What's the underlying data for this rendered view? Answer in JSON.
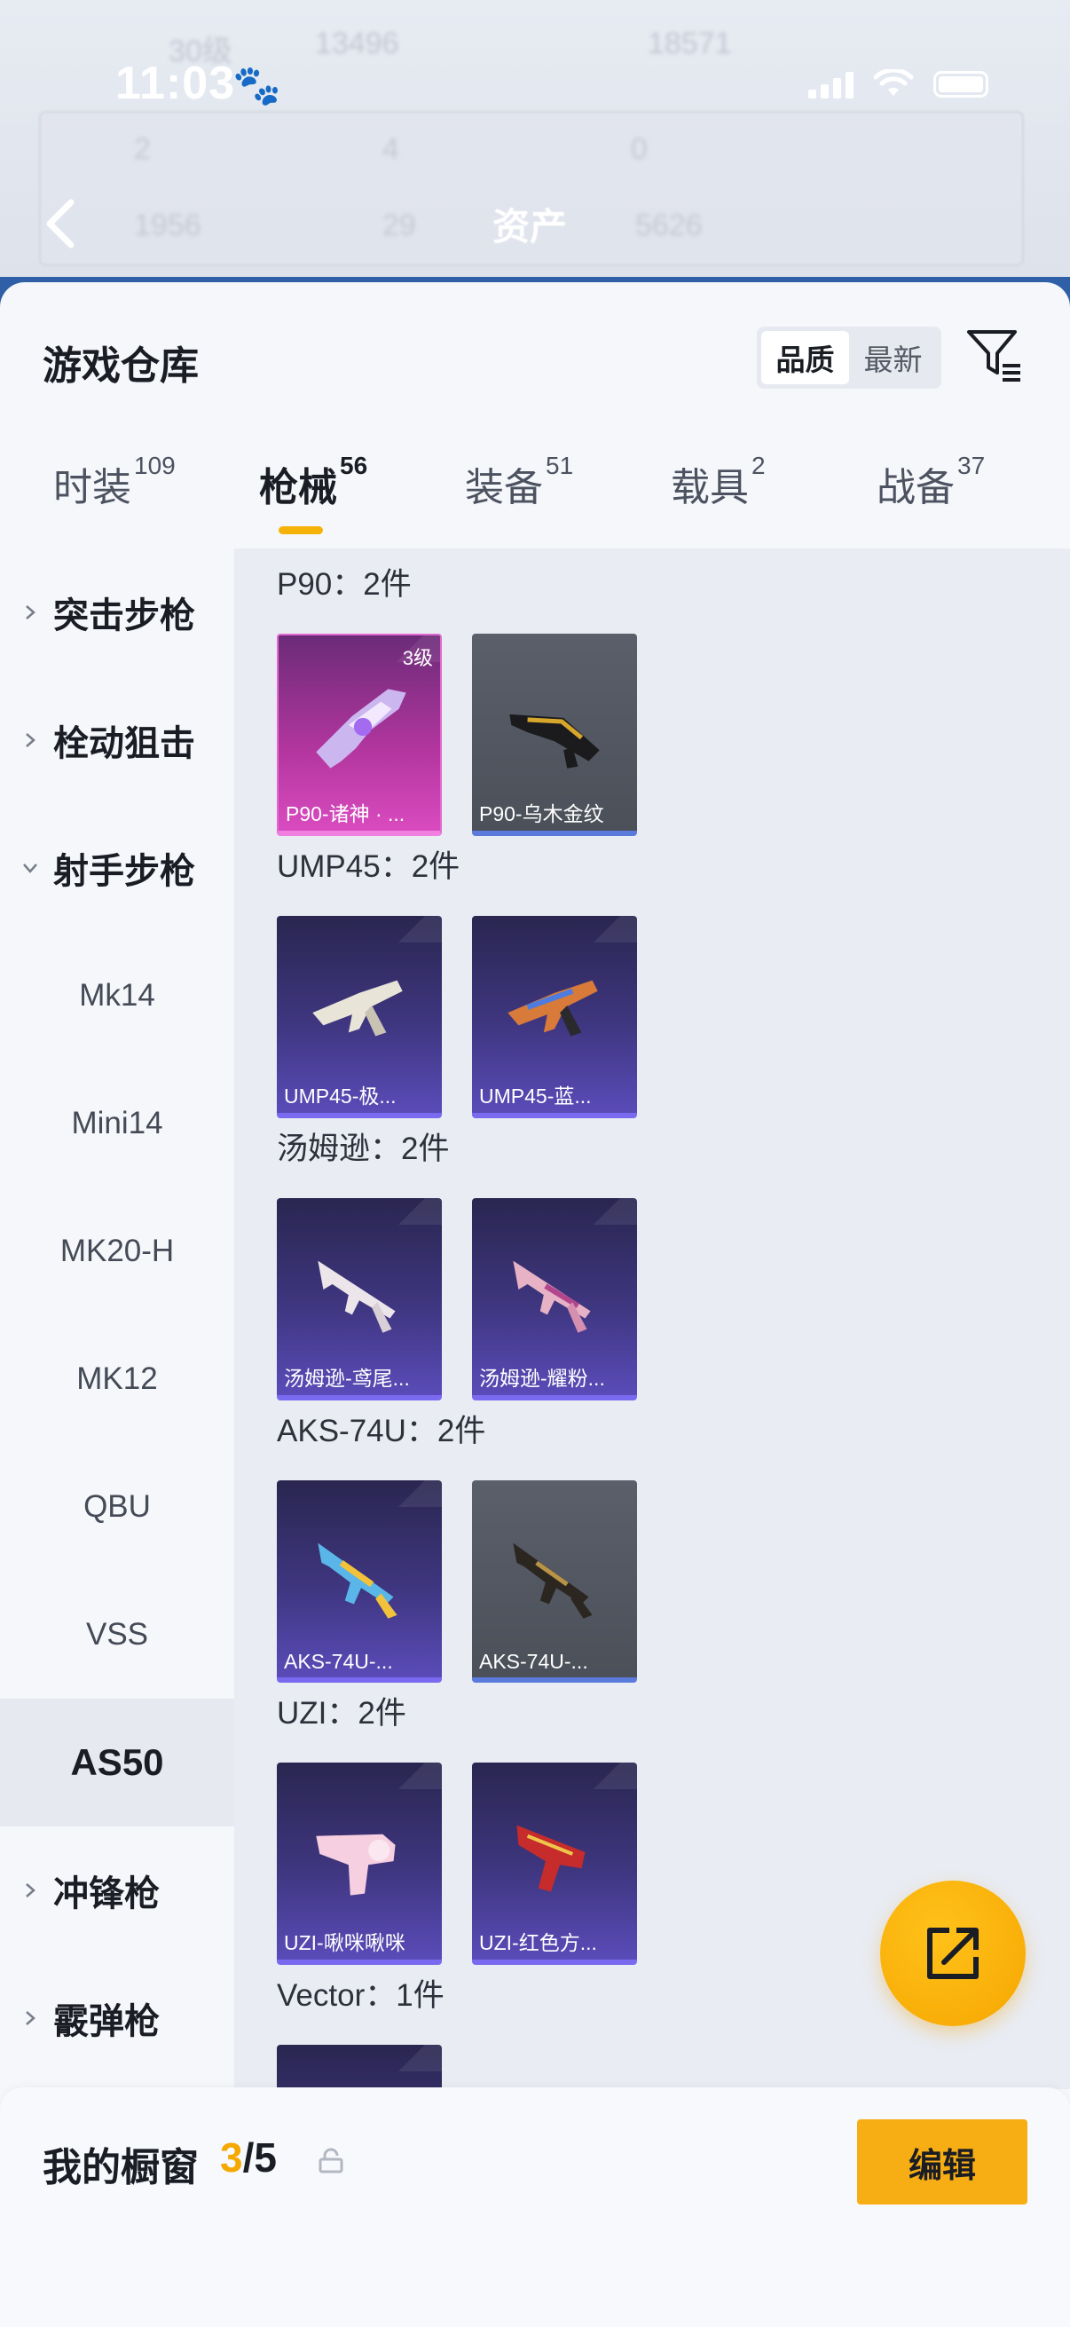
{
  "status": {
    "time": "11:03",
    "paw": "🐾"
  },
  "header": {
    "asset_title": "资产",
    "blur_texts": [
      "30级",
      "13496",
      "18571",
      "2",
      "4",
      "0",
      "1956",
      "29",
      "5626"
    ]
  },
  "sheet": {
    "title": "游戏仓库",
    "sort": {
      "options": [
        "品质",
        "最新"
      ],
      "active": "品质"
    }
  },
  "tabs": [
    {
      "label": "时装",
      "count": "109"
    },
    {
      "label": "枪械",
      "count": "56",
      "active": true
    },
    {
      "label": "装备",
      "count": "51"
    },
    {
      "label": "载具",
      "count": "2"
    },
    {
      "label": "战备",
      "count": "37"
    }
  ],
  "categories": {
    "assault": "突击步枪",
    "bolt": "栓动狙击",
    "marksman": "射手步枪",
    "marksman_items": [
      "Mk14",
      "Mini14",
      "MK20-H",
      "MK12",
      "QBU",
      "VSS",
      "AS50"
    ],
    "selected": "AS50",
    "smg": "冲锋枪",
    "shotgun": "霰弹枪"
  },
  "groups": [
    {
      "title": "P90：2件",
      "items": [
        {
          "name": "P90-诸神 · ...",
          "level": "3级",
          "rarity": "pink"
        },
        {
          "name": "P90-乌木金纹",
          "rarity": "gray"
        }
      ]
    },
    {
      "title": "UMP45：2件",
      "items": [
        {
          "name": "UMP45-极...",
          "rarity": "purple"
        },
        {
          "name": "UMP45-蓝...",
          "rarity": "purple"
        }
      ]
    },
    {
      "title": "汤姆逊：2件",
      "items": [
        {
          "name": "汤姆逊-鸢尾...",
          "rarity": "purple"
        },
        {
          "name": "汤姆逊-耀粉...",
          "rarity": "purple"
        }
      ]
    },
    {
      "title": "AKS-74U：2件",
      "items": [
        {
          "name": "AKS-74U-...",
          "rarity": "purple"
        },
        {
          "name": "AKS-74U-...",
          "rarity": "gray"
        }
      ]
    },
    {
      "title": "UZI：2件",
      "items": [
        {
          "name": "UZI-啾咪啾咪",
          "rarity": "purple"
        },
        {
          "name": "UZI-红色方...",
          "rarity": "purple"
        }
      ]
    },
    {
      "title": "Vector：1件",
      "items": [
        {
          "name": "",
          "rarity": "purple"
        }
      ]
    }
  ],
  "bottom": {
    "label": "我的橱窗",
    "current": "3",
    "separator": "/",
    "max": "5",
    "edit": "编辑"
  },
  "colors": {
    "accent": "#f5b30a",
    "sheet_bg": "#f5f7fb",
    "content_bg": "#e9ecf3"
  }
}
